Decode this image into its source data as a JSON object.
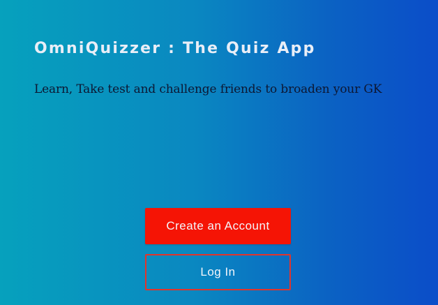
{
  "header": {
    "title": "OmniQuizzer : The Quiz App",
    "subtitle": "Learn, Take test and challenge friends to broaden your GK"
  },
  "actions": {
    "create_account_label": "Create an Account",
    "login_label": "Log In"
  },
  "colors": {
    "background_start": "#06a1bd",
    "background_end": "#0b4dc9",
    "primary_button": "#f51405",
    "secondary_button_border": "#e3342a",
    "title_text": "#e9eef7",
    "subtitle_text": "#0d1732"
  }
}
